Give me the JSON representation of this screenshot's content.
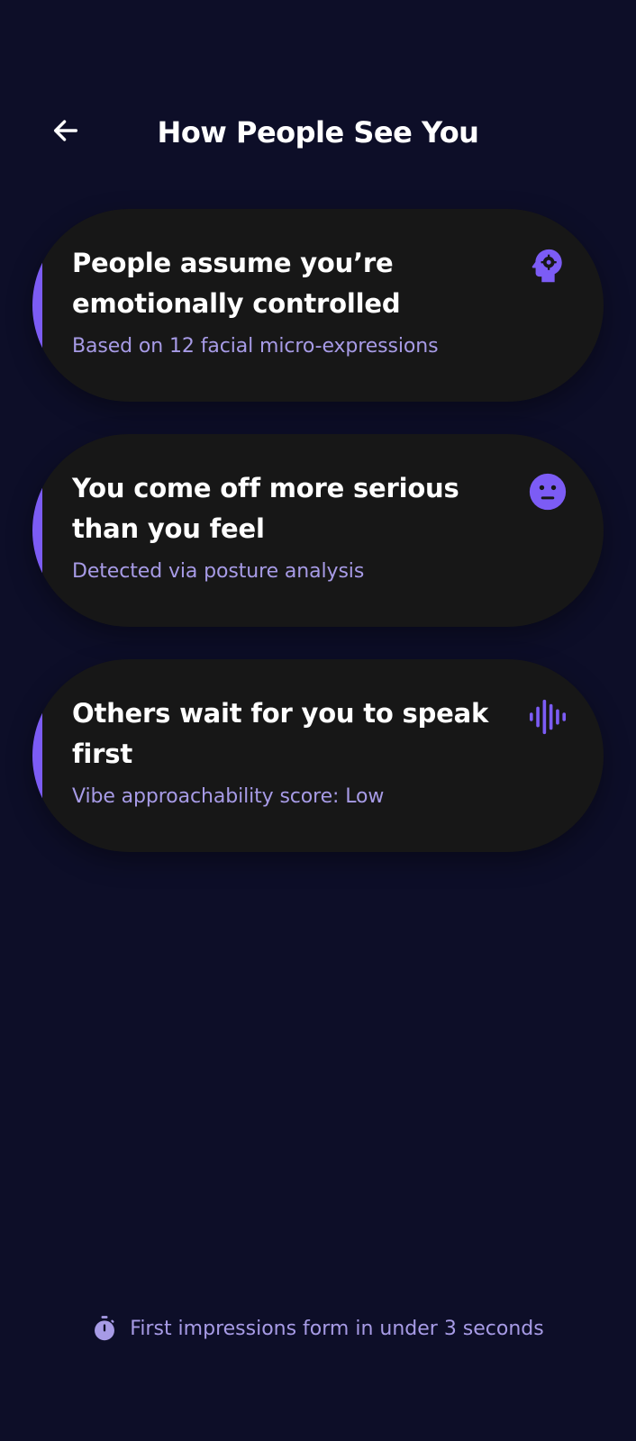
{
  "header": {
    "back_icon": "arrow-left-icon",
    "title": "How People See You"
  },
  "cards": [
    {
      "title": "People assume you’re emotionally controlled",
      "subtitle": "Based on 12 facial micro-expressions",
      "icon": "head-gear-icon"
    },
    {
      "title": "You come off more serious than you feel",
      "subtitle": "Detected via posture analysis",
      "icon": "neutral-face-icon"
    },
    {
      "title": "Others wait for you to speak first",
      "subtitle": "Vibe approachability score: Low",
      "icon": "sound-wave-icon"
    }
  ],
  "footer": {
    "icon": "stopwatch-icon",
    "text": "First impressions form in under 3 seconds"
  },
  "colors": {
    "background": "#0d0e28",
    "card": "#171717",
    "accent": "#7c5cf5",
    "subtext": "#a79be6"
  }
}
